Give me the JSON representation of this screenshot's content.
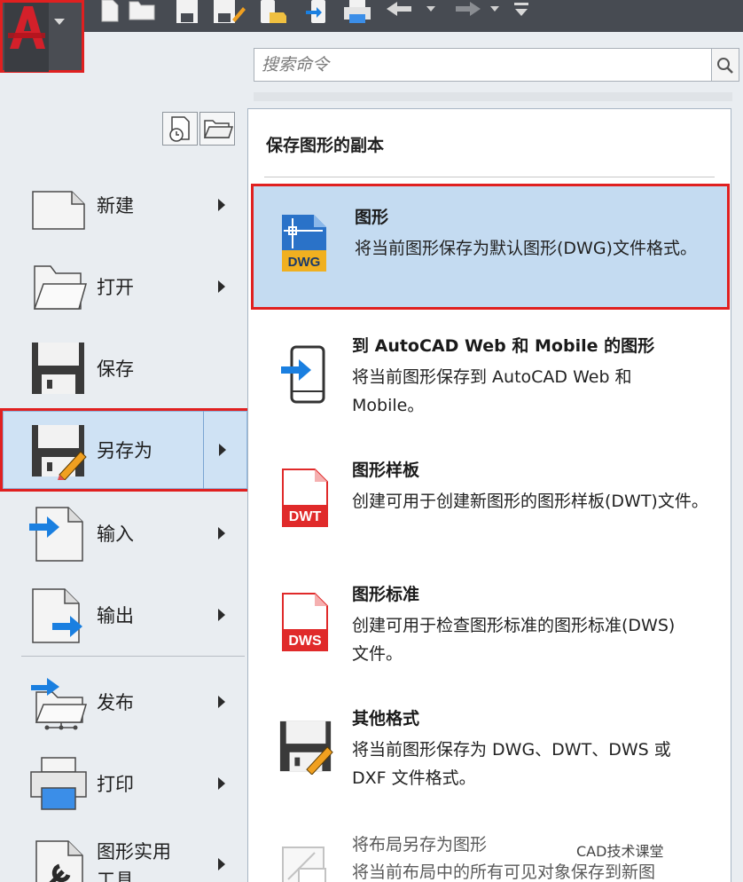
{
  "quick_access_toolbar": {
    "icons": [
      "new-icon",
      "open-icon",
      "save-icon",
      "save-as-icon",
      "open-from-web-icon",
      "save-to-web-icon",
      "plot-icon",
      "undo-icon",
      "redo-icon",
      "customize-icon"
    ]
  },
  "search": {
    "placeholder": "搜索命令"
  },
  "left_menu": {
    "items": [
      {
        "label": "新建",
        "icon": "new-drawing-icon",
        "has_submenu": true
      },
      {
        "label": "打开",
        "icon": "open-folder-icon",
        "has_submenu": true
      },
      {
        "label": "保存",
        "icon": "save-disk-icon",
        "has_submenu": false
      },
      {
        "label": "另存为",
        "icon": "save-as-disk-icon",
        "has_submenu": true,
        "selected": true
      },
      {
        "label": "输入",
        "icon": "import-icon",
        "has_submenu": true
      },
      {
        "label": "输出",
        "icon": "export-icon",
        "has_submenu": true
      },
      {
        "label": "发布",
        "icon": "publish-icon",
        "has_submenu": true
      },
      {
        "label": "打印",
        "icon": "printer-icon",
        "has_submenu": true
      },
      {
        "label_line1": "图形实用",
        "label_line2": "工具",
        "icon": "drawing-utilities-icon",
        "has_submenu": true
      }
    ]
  },
  "sub_panel": {
    "title": "保存图形的副本",
    "items": [
      {
        "title": "图形",
        "description": "将当前图形保存为默认图形(DWG)文件格式。",
        "icon": "dwg-file-icon",
        "icon_text": "DWG",
        "highlighted": true
      },
      {
        "title": "到 AutoCAD Web 和 Mobile 的图形",
        "description": "将当前图形保存到 AutoCAD Web 和 Mobile。",
        "icon": "save-to-web-mobile-icon"
      },
      {
        "title": "图形样板",
        "description": "创建可用于创建新图形的图形样板(DWT)文件。",
        "icon": "dwt-file-icon",
        "icon_text": "DWT"
      },
      {
        "title": "图形标准",
        "description": "创建可用于检查图形标准的图形标准(DWS)文件。",
        "icon": "dws-file-icon",
        "icon_text": "DWS"
      },
      {
        "title": "其他格式",
        "description": "将当前图形保存为 DWG、DWT、DWS 或 DXF 文件格式。",
        "icon": "save-other-formats-icon"
      },
      {
        "title": "将布局另存为图形",
        "description": "将当前布局中的所有可见对象保存到新图",
        "icon": "save-layout-as-drawing-icon",
        "disabled": true
      }
    ]
  },
  "watermark": {
    "text": "CAD技术课堂"
  },
  "colors": {
    "title_bar": "#474b52",
    "selection_fill": "#c4dbf1",
    "highlight_border": "#e02020",
    "arrow_blue": "#1a7fe0",
    "file_red": "#e02a2a",
    "dwg_blue": "#2a72c8",
    "dwg_yellow": "#f0b020"
  }
}
